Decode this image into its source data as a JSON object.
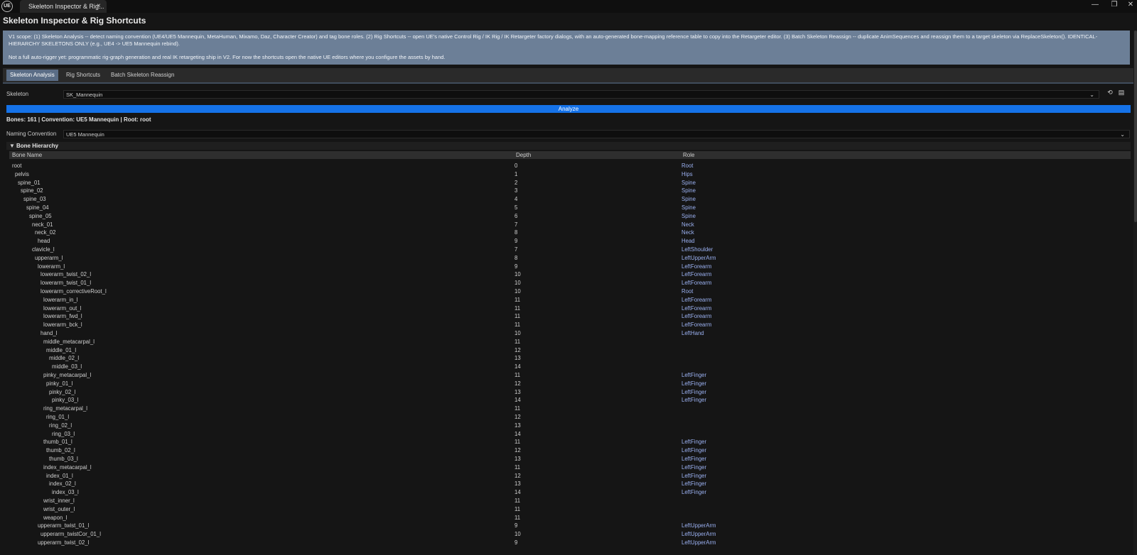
{
  "app_tab": {
    "logo": "UE",
    "label": "Skeleton Inspector & Rig...",
    "close": "×"
  },
  "window_controls": {
    "minimize": "—",
    "restore": "❐",
    "close": "✕"
  },
  "window_title": "Skeleton Inspector & Rig Shortcuts",
  "info": {
    "p1": "V1 scope: (1) Skeleton Analysis -- detect naming convention (UE4/UE5 Mannequin, MetaHuman, Mixamo, Daz, Character Creator) and tag bone roles. (2) Rig Shortcuts -- open UE's native Control Rig / IK Rig / IK Retargeter factory dialogs, with an auto-generated bone-mapping reference table to copy into the Retargeter editor. (3) Batch Skeleton Reassign -- duplicate AnimSequences and reassign them to a target skeleton via ReplaceSkeleton(). IDENTICAL-HIERARCHY SKELETONS ONLY (e.g., UE4 -> UE5 Mannequin rebind).",
    "p2": "Not a full auto-rigger yet: programmatic rig-graph generation and real IK retargeting ship in V2. For now the shortcuts open the native UE editors where you configure the assets by hand."
  },
  "tabs": [
    {
      "label": "Skeleton Analysis",
      "active": true
    },
    {
      "label": "Rig Shortcuts",
      "active": false
    },
    {
      "label": "Batch Skeleton Reassign",
      "active": false
    }
  ],
  "skeleton": {
    "label": "Skeleton",
    "value": "SK_Mannequin",
    "chevron": "⌄",
    "icons": [
      "⟲",
      "▤"
    ]
  },
  "analyze_label": "Analyze",
  "stats": "Bones: 161 | Convention: UE5 Mannequin | Root: root",
  "naming": {
    "label": "Naming Convention",
    "value": "UE5 Mannequin",
    "chevron": "⌄"
  },
  "hierarchy": {
    "title": "Bone Hierarchy",
    "toggle": "▼",
    "columns": {
      "bone": "Bone Name",
      "depth": "Depth",
      "role": "Role"
    },
    "rows": [
      {
        "name": "root",
        "depth": "0",
        "role": "Root"
      },
      {
        "name": "pelvis",
        "depth": "1",
        "role": "Hips"
      },
      {
        "name": "spine_01",
        "depth": "2",
        "role": "Spine"
      },
      {
        "name": "spine_02",
        "depth": "3",
        "role": "Spine"
      },
      {
        "name": "spine_03",
        "depth": "4",
        "role": "Spine"
      },
      {
        "name": "spine_04",
        "depth": "5",
        "role": "Spine"
      },
      {
        "name": "spine_05",
        "depth": "6",
        "role": "Spine"
      },
      {
        "name": "neck_01",
        "depth": "7",
        "role": "Neck"
      },
      {
        "name": "neck_02",
        "depth": "8",
        "role": "Neck"
      },
      {
        "name": "head",
        "depth": "9",
        "role": "Head"
      },
      {
        "name": "clavicle_l",
        "depth": "7",
        "role": "LeftShoulder"
      },
      {
        "name": "upperarm_l",
        "depth": "8",
        "role": "LeftUpperArm"
      },
      {
        "name": "lowerarm_l",
        "depth": "9",
        "role": "LeftForearm"
      },
      {
        "name": "lowerarm_twist_02_l",
        "depth": "10",
        "role": "LeftForearm"
      },
      {
        "name": "lowerarm_twist_01_l",
        "depth": "10",
        "role": "LeftForearm"
      },
      {
        "name": "lowerarm_correctiveRoot_l",
        "depth": "10",
        "role": "Root"
      },
      {
        "name": "lowerarm_in_l",
        "depth": "11",
        "role": "LeftForearm"
      },
      {
        "name": "lowerarm_out_l",
        "depth": "11",
        "role": "LeftForearm"
      },
      {
        "name": "lowerarm_fwd_l",
        "depth": "11",
        "role": "LeftForearm"
      },
      {
        "name": "lowerarm_bck_l",
        "depth": "11",
        "role": "LeftForearm"
      },
      {
        "name": "hand_l",
        "depth": "10",
        "role": "LeftHand"
      },
      {
        "name": "middle_metacarpal_l",
        "depth": "11",
        "role": ""
      },
      {
        "name": "middle_01_l",
        "depth": "12",
        "role": ""
      },
      {
        "name": "middle_02_l",
        "depth": "13",
        "role": ""
      },
      {
        "name": "middle_03_l",
        "depth": "14",
        "role": ""
      },
      {
        "name": "pinky_metacarpal_l",
        "depth": "11",
        "role": "LeftFinger"
      },
      {
        "name": "pinky_01_l",
        "depth": "12",
        "role": "LeftFinger"
      },
      {
        "name": "pinky_02_l",
        "depth": "13",
        "role": "LeftFinger"
      },
      {
        "name": "pinky_03_l",
        "depth": "14",
        "role": "LeftFinger"
      },
      {
        "name": "ring_metacarpal_l",
        "depth": "11",
        "role": ""
      },
      {
        "name": "ring_01_l",
        "depth": "12",
        "role": ""
      },
      {
        "name": "ring_02_l",
        "depth": "13",
        "role": ""
      },
      {
        "name": "ring_03_l",
        "depth": "14",
        "role": ""
      },
      {
        "name": "thumb_01_l",
        "depth": "11",
        "role": "LeftFinger"
      },
      {
        "name": "thumb_02_l",
        "depth": "12",
        "role": "LeftFinger"
      },
      {
        "name": "thumb_03_l",
        "depth": "13",
        "role": "LeftFinger"
      },
      {
        "name": "index_metacarpal_l",
        "depth": "11",
        "role": "LeftFinger"
      },
      {
        "name": "index_01_l",
        "depth": "12",
        "role": "LeftFinger"
      },
      {
        "name": "index_02_l",
        "depth": "13",
        "role": "LeftFinger"
      },
      {
        "name": "index_03_l",
        "depth": "14",
        "role": "LeftFinger"
      },
      {
        "name": "wrist_inner_l",
        "depth": "11",
        "role": ""
      },
      {
        "name": "wrist_outer_l",
        "depth": "11",
        "role": ""
      },
      {
        "name": "weapon_l",
        "depth": "11",
        "role": ""
      },
      {
        "name": "upperarm_twist_01_l",
        "depth": "9",
        "role": "LeftUpperArm"
      },
      {
        "name": "upperarm_twistCor_01_l",
        "depth": "10",
        "role": "LeftUpperArm"
      },
      {
        "name": "upperarm_twist_02_l",
        "depth": "9",
        "role": "LeftUpperArm"
      }
    ]
  },
  "colors": {
    "accent": "#1572e8",
    "info_bg": "#6c7f97",
    "role_text": "#9ab0f0",
    "active_tab": "#5a6d86"
  }
}
